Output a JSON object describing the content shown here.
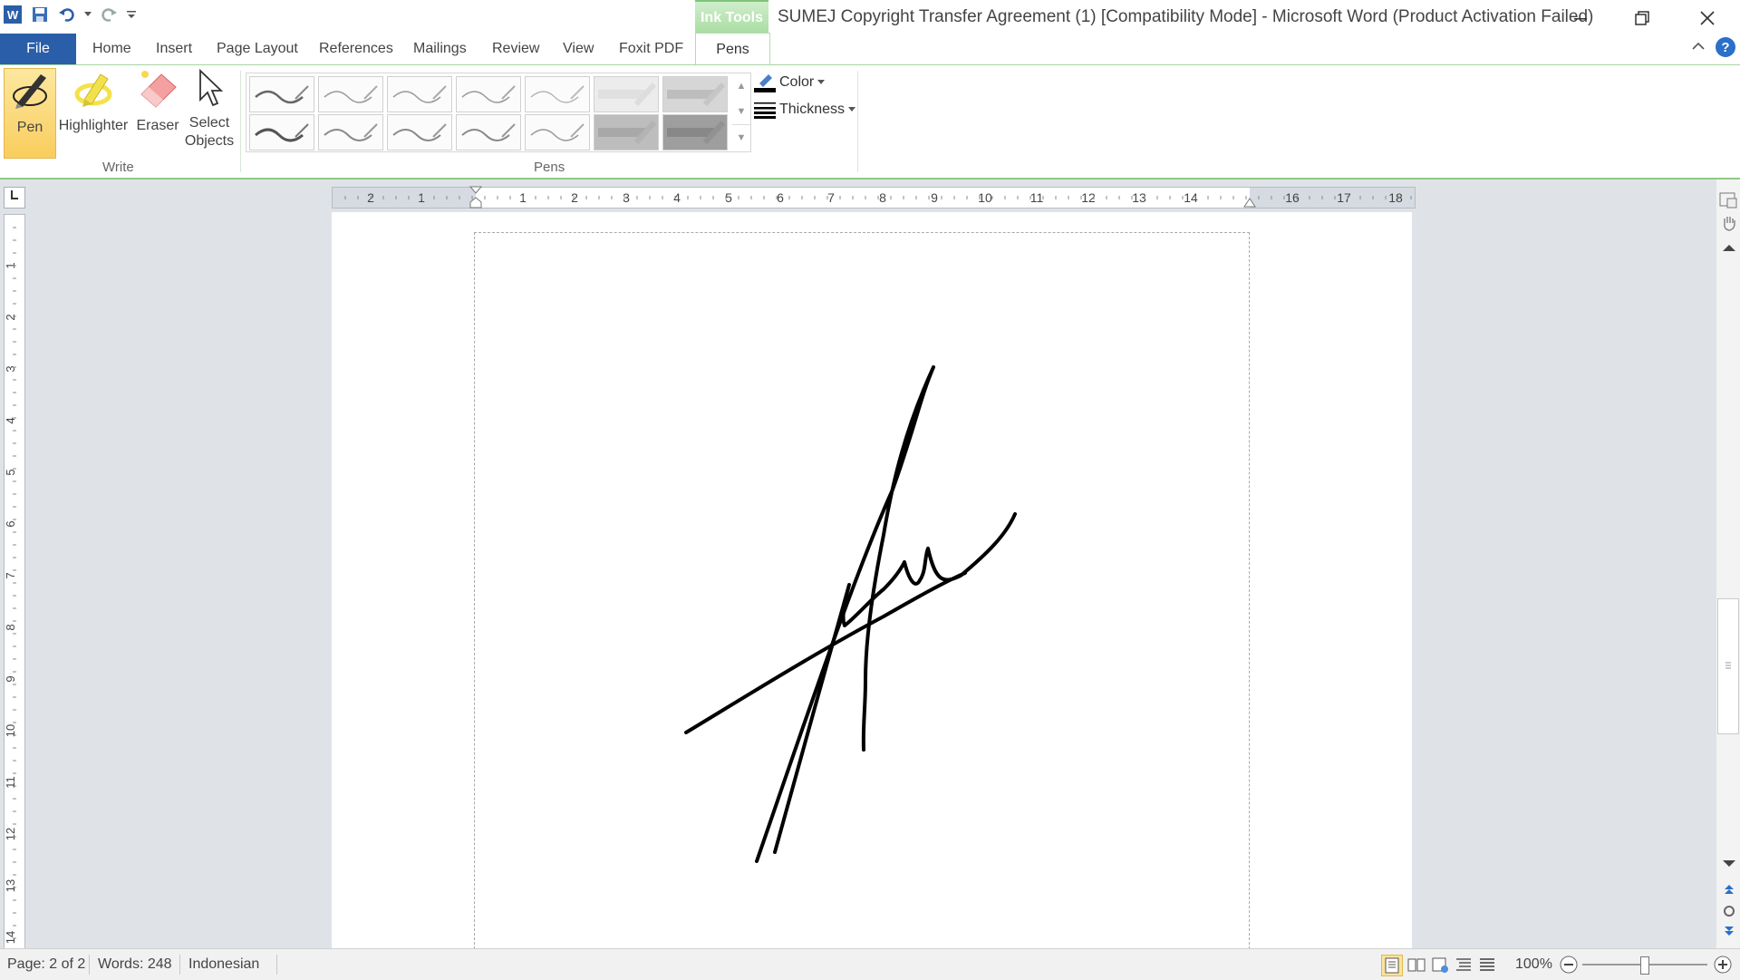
{
  "window": {
    "title": "SUMEJ Copyright Transfer Agreement (1) [Compatibility Mode]  -  Microsoft Word (Product Activation Failed)",
    "contextual_tab_group": "Ink Tools"
  },
  "tabs": [
    {
      "label": "File",
      "active": false
    },
    {
      "label": "Home",
      "active": false
    },
    {
      "label": "Insert",
      "active": false
    },
    {
      "label": "Page Layout",
      "active": false
    },
    {
      "label": "References",
      "active": false
    },
    {
      "label": "Mailings",
      "active": false
    },
    {
      "label": "Review",
      "active": false
    },
    {
      "label": "View",
      "active": false
    },
    {
      "label": "Foxit PDF",
      "active": false
    },
    {
      "label": "Pens",
      "active": true
    }
  ],
  "ribbon": {
    "write_group": {
      "label": "Write",
      "tools": [
        {
          "label": "Pen",
          "icon": "pen-icon",
          "selected": true
        },
        {
          "label": "Highlighter",
          "icon": "highlighter-icon",
          "selected": false
        },
        {
          "label": "Eraser",
          "icon": "eraser-icon",
          "selected": false
        },
        {
          "label_line1": "Select",
          "label_line2": "Objects",
          "icon": "cursor-icon",
          "selected": false
        }
      ]
    },
    "pens_group": {
      "label": "Pens",
      "color_label": "Color",
      "thickness_label": "Thickness"
    }
  },
  "ruler": {
    "horizontal_labels": [
      "2",
      "1",
      "1",
      "2",
      "3",
      "4",
      "5",
      "6",
      "7",
      "8",
      "9",
      "10",
      "11",
      "12",
      "13",
      "14",
      "16",
      "17",
      "18"
    ],
    "vertical_labels": [
      "1",
      "2",
      "3",
      "4",
      "5",
      "6",
      "7",
      "8",
      "9",
      "10",
      "11",
      "12",
      "13",
      "14"
    ]
  },
  "statusbar": {
    "page": "Page: 2 of 2",
    "words": "Words: 248",
    "language": "Indonesian",
    "zoom": "100%"
  },
  "colors": {
    "file_tab": "#2a5ea8",
    "ink_tools_accent": "#a8dca1",
    "pen_selected": "#f9cd5d",
    "ink": "#000000"
  }
}
